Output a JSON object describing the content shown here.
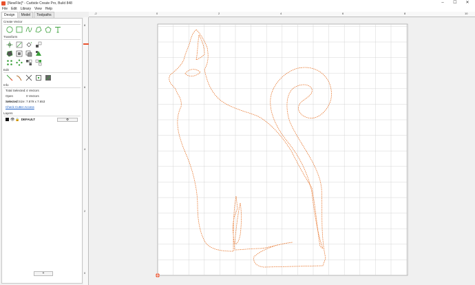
{
  "window": {
    "title": "[NewFile]* - Carbide Create Pro, Build 848",
    "controls": [
      "–",
      "☐",
      "✕"
    ]
  },
  "menu": [
    "File",
    "Edit",
    "Library",
    "View",
    "Help"
  ],
  "tabs": [
    {
      "label": "Design",
      "active": true
    },
    {
      "label": "Model",
      "active": false
    },
    {
      "label": "Toolpaths",
      "active": false
    }
  ],
  "sections": {
    "create_vector": "Create Vector",
    "transform": "Transform",
    "edit": "Edit",
    "info": "Info",
    "layers": "Layers"
  },
  "create_vector_tools": [
    "circle-icon",
    "square-icon",
    "curve-icon",
    "polygon-icon",
    "pentagon-icon",
    "text-icon"
  ],
  "transform_tools_row1": [
    "move-icon",
    "scale-icon",
    "rotate-icon",
    "mirror-icon"
  ],
  "transform_tools_row2": [
    "offset-icon",
    "align-icon",
    "boolean-icon",
    "weld-icon"
  ],
  "transform_tools_row3": [
    "array-icon",
    "circular-array-icon",
    "group-icon",
    "ungroup-icon"
  ],
  "edit_tools": [
    "node-edit-icon",
    "trim-icon",
    "cut-icon",
    "join-icon",
    "smooth-icon"
  ],
  "info": {
    "rows": [
      {
        "key": "Total Selected:",
        "value": "4 Vectors"
      },
      {
        "key": "Open Selected:",
        "value": "0 Vectors"
      },
      {
        "key": "Selected Size:",
        "value": "7.879 x 7.653"
      }
    ],
    "link": "Check Cutter Access"
  },
  "layers": [
    {
      "name": "DEFAULT",
      "color": "#111111"
    }
  ],
  "layers_add": "+",
  "ruler_top_labels": [
    "-2",
    "0",
    "2",
    "4",
    "6",
    "8",
    "10"
  ],
  "ruler_left_labels": [
    "8",
    "6",
    "4",
    "2",
    "0"
  ],
  "colors": {
    "accent": "#e8512d",
    "vector": "#e8772e",
    "grid": "#d4d4d4",
    "stock_bg": "#ffffff",
    "link": "#1a5fc7"
  }
}
